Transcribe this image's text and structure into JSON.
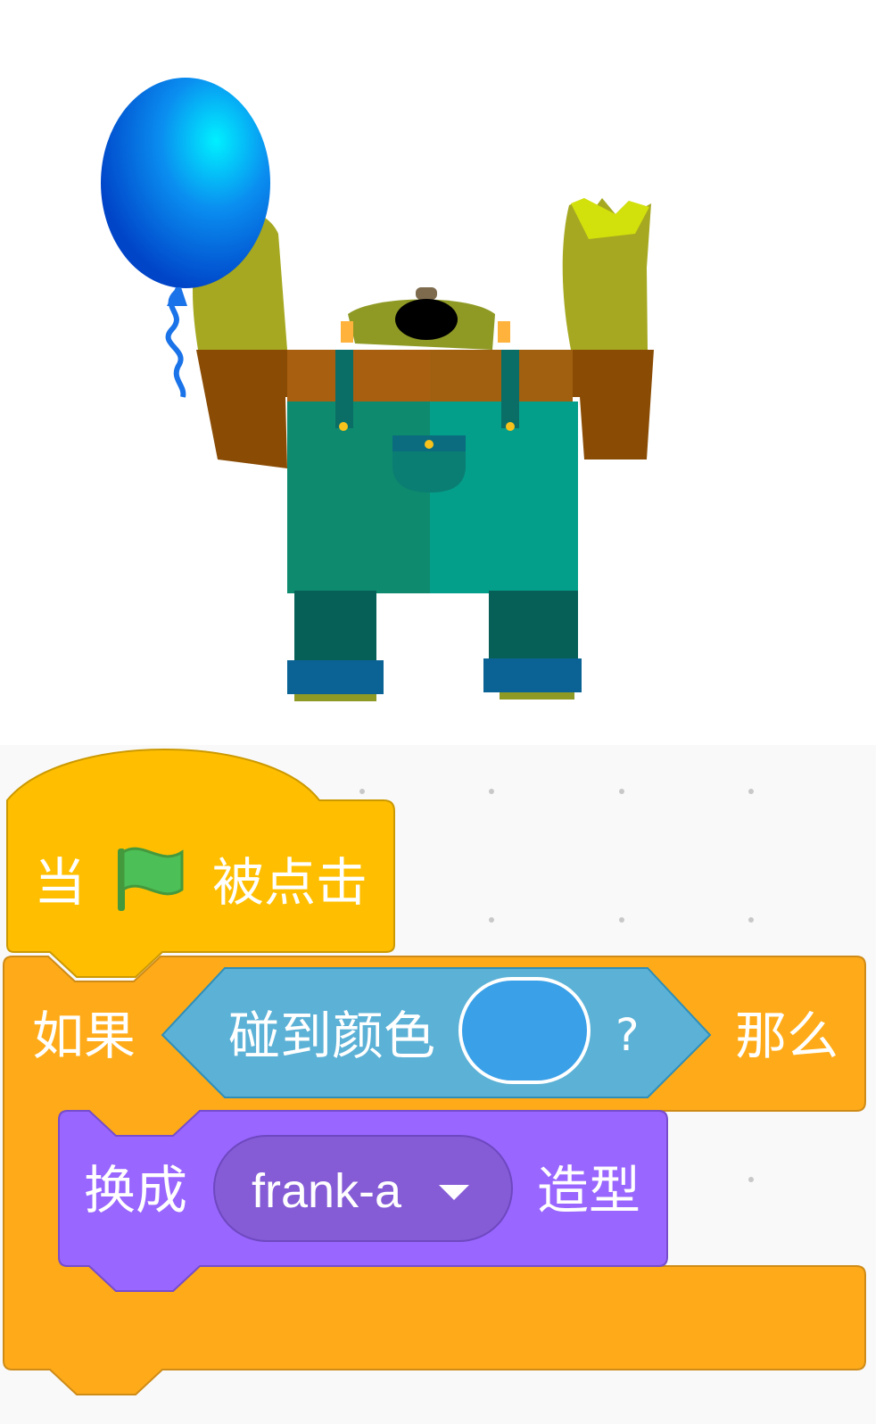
{
  "stage": {
    "sprite_icon": "frank-monster-with-balloon"
  },
  "script": {
    "hat_block": {
      "prefix": "当",
      "flag_icon": "green-flag-icon",
      "suffix": "被点击",
      "color": "#FFBF00"
    },
    "if_block": {
      "if_label": "如果",
      "then_label": "那么",
      "color": "#FFAB19",
      "condition": {
        "label": "碰到颜色",
        "question_mark": "?",
        "color_value": "#3AA0E8",
        "block_color": "#5CB1D6"
      },
      "body": {
        "switch_costume": {
          "prefix": "换成",
          "costume": "frank-a",
          "suffix": "造型",
          "color": "#9966FF",
          "dropdown_color": "#855CD6"
        }
      }
    }
  }
}
